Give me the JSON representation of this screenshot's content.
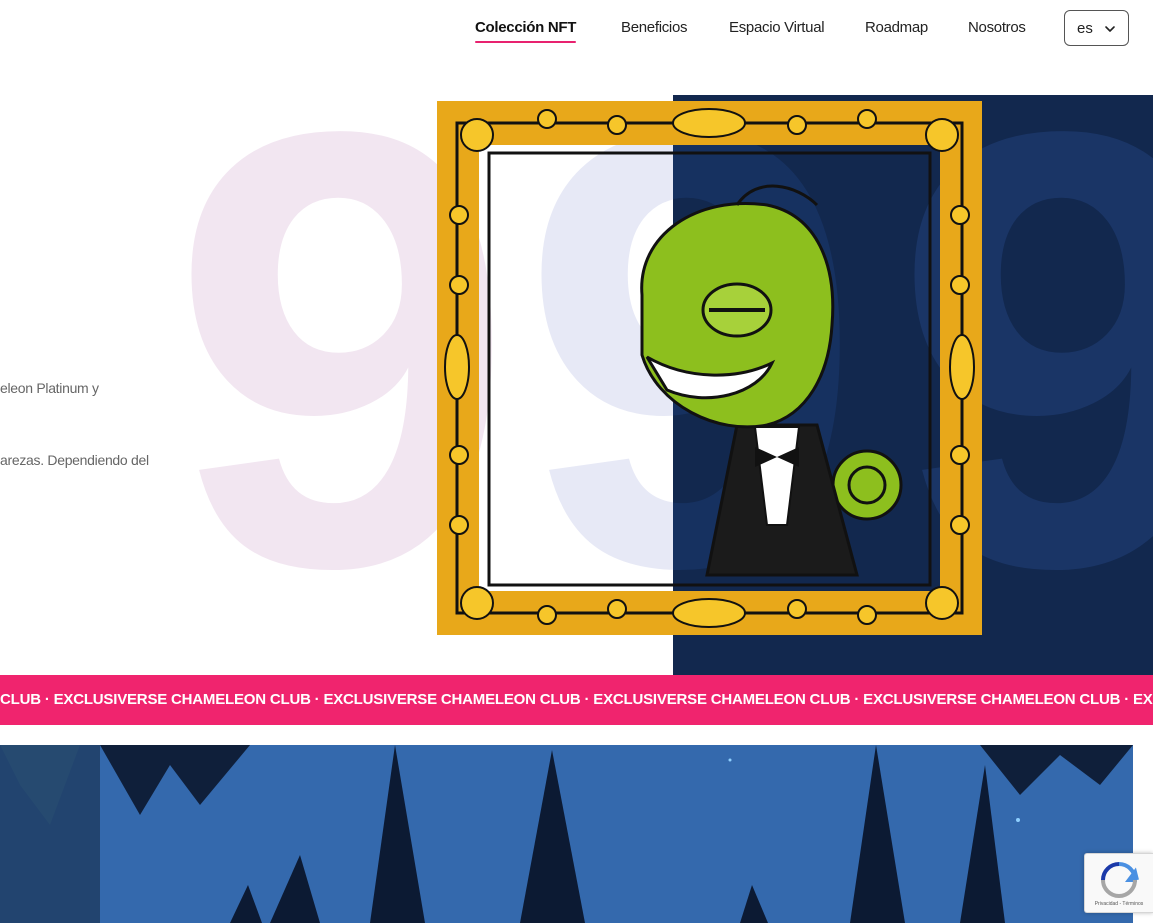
{
  "nav": {
    "items": [
      {
        "label": "Colección NFT",
        "active": true
      },
      {
        "label": "Beneficios",
        "active": false
      },
      {
        "label": "Espacio Virtual",
        "active": false
      },
      {
        "label": "Roadmap",
        "active": false
      },
      {
        "label": "Nosotros",
        "active": false
      }
    ],
    "language": {
      "selected": "es",
      "icon": "chevron-down-icon"
    },
    "accent_color": "#e8226f"
  },
  "hero": {
    "text_line_1": "eleon Platinum y",
    "text_line_2": "arezas. Dependiendo del",
    "background_number": "99",
    "artwork_icon": "chameleon-in-tuxedo-framed-artwork",
    "panel_color": "#12284e"
  },
  "marquee": {
    "text": "CLUB · EXCLUSIVERSE CHAMELEON CLUB · EXCLUSIVERSE CHAMELEON CLUB · EXCLUSIVERSE CHAMELEON CLUB · EXCLUSIVERSE CHAMELEON CLUB · EXCLUSIVERSE CHAMELEON CLUB",
    "color": "#f0246e"
  },
  "recaptcha": {
    "label": "Privacidad - Términos",
    "icon": "recaptcha-icon"
  }
}
